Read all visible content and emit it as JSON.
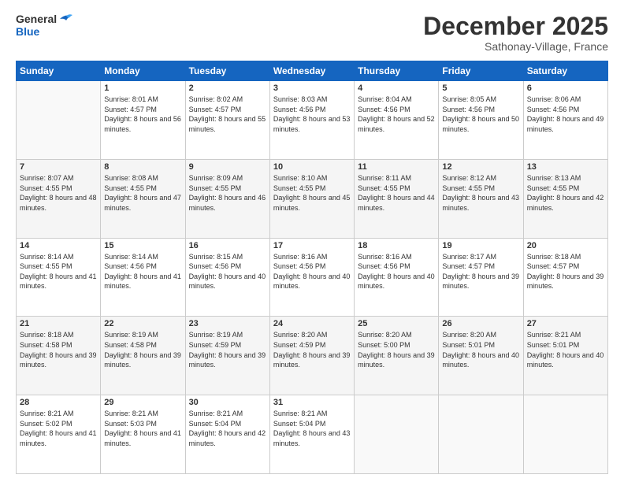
{
  "logo": {
    "line1": "General",
    "line2": "Blue"
  },
  "header": {
    "month": "December 2025",
    "location": "Sathonay-Village, France"
  },
  "weekdays": [
    "Sunday",
    "Monday",
    "Tuesday",
    "Wednesday",
    "Thursday",
    "Friday",
    "Saturday"
  ],
  "weeks": [
    [
      {
        "day": "",
        "sunrise": "",
        "sunset": "",
        "daylight": ""
      },
      {
        "day": "1",
        "sunrise": "Sunrise: 8:01 AM",
        "sunset": "Sunset: 4:57 PM",
        "daylight": "Daylight: 8 hours and 56 minutes."
      },
      {
        "day": "2",
        "sunrise": "Sunrise: 8:02 AM",
        "sunset": "Sunset: 4:57 PM",
        "daylight": "Daylight: 8 hours and 55 minutes."
      },
      {
        "day": "3",
        "sunrise": "Sunrise: 8:03 AM",
        "sunset": "Sunset: 4:56 PM",
        "daylight": "Daylight: 8 hours and 53 minutes."
      },
      {
        "day": "4",
        "sunrise": "Sunrise: 8:04 AM",
        "sunset": "Sunset: 4:56 PM",
        "daylight": "Daylight: 8 hours and 52 minutes."
      },
      {
        "day": "5",
        "sunrise": "Sunrise: 8:05 AM",
        "sunset": "Sunset: 4:56 PM",
        "daylight": "Daylight: 8 hours and 50 minutes."
      },
      {
        "day": "6",
        "sunrise": "Sunrise: 8:06 AM",
        "sunset": "Sunset: 4:56 PM",
        "daylight": "Daylight: 8 hours and 49 minutes."
      }
    ],
    [
      {
        "day": "7",
        "sunrise": "Sunrise: 8:07 AM",
        "sunset": "Sunset: 4:55 PM",
        "daylight": "Daylight: 8 hours and 48 minutes."
      },
      {
        "day": "8",
        "sunrise": "Sunrise: 8:08 AM",
        "sunset": "Sunset: 4:55 PM",
        "daylight": "Daylight: 8 hours and 47 minutes."
      },
      {
        "day": "9",
        "sunrise": "Sunrise: 8:09 AM",
        "sunset": "Sunset: 4:55 PM",
        "daylight": "Daylight: 8 hours and 46 minutes."
      },
      {
        "day": "10",
        "sunrise": "Sunrise: 8:10 AM",
        "sunset": "Sunset: 4:55 PM",
        "daylight": "Daylight: 8 hours and 45 minutes."
      },
      {
        "day": "11",
        "sunrise": "Sunrise: 8:11 AM",
        "sunset": "Sunset: 4:55 PM",
        "daylight": "Daylight: 8 hours and 44 minutes."
      },
      {
        "day": "12",
        "sunrise": "Sunrise: 8:12 AM",
        "sunset": "Sunset: 4:55 PM",
        "daylight": "Daylight: 8 hours and 43 minutes."
      },
      {
        "day": "13",
        "sunrise": "Sunrise: 8:13 AM",
        "sunset": "Sunset: 4:55 PM",
        "daylight": "Daylight: 8 hours and 42 minutes."
      }
    ],
    [
      {
        "day": "14",
        "sunrise": "Sunrise: 8:14 AM",
        "sunset": "Sunset: 4:55 PM",
        "daylight": "Daylight: 8 hours and 41 minutes."
      },
      {
        "day": "15",
        "sunrise": "Sunrise: 8:14 AM",
        "sunset": "Sunset: 4:56 PM",
        "daylight": "Daylight: 8 hours and 41 minutes."
      },
      {
        "day": "16",
        "sunrise": "Sunrise: 8:15 AM",
        "sunset": "Sunset: 4:56 PM",
        "daylight": "Daylight: 8 hours and 40 minutes."
      },
      {
        "day": "17",
        "sunrise": "Sunrise: 8:16 AM",
        "sunset": "Sunset: 4:56 PM",
        "daylight": "Daylight: 8 hours and 40 minutes."
      },
      {
        "day": "18",
        "sunrise": "Sunrise: 8:16 AM",
        "sunset": "Sunset: 4:56 PM",
        "daylight": "Daylight: 8 hours and 40 minutes."
      },
      {
        "day": "19",
        "sunrise": "Sunrise: 8:17 AM",
        "sunset": "Sunset: 4:57 PM",
        "daylight": "Daylight: 8 hours and 39 minutes."
      },
      {
        "day": "20",
        "sunrise": "Sunrise: 8:18 AM",
        "sunset": "Sunset: 4:57 PM",
        "daylight": "Daylight: 8 hours and 39 minutes."
      }
    ],
    [
      {
        "day": "21",
        "sunrise": "Sunrise: 8:18 AM",
        "sunset": "Sunset: 4:58 PM",
        "daylight": "Daylight: 8 hours and 39 minutes."
      },
      {
        "day": "22",
        "sunrise": "Sunrise: 8:19 AM",
        "sunset": "Sunset: 4:58 PM",
        "daylight": "Daylight: 8 hours and 39 minutes."
      },
      {
        "day": "23",
        "sunrise": "Sunrise: 8:19 AM",
        "sunset": "Sunset: 4:59 PM",
        "daylight": "Daylight: 8 hours and 39 minutes."
      },
      {
        "day": "24",
        "sunrise": "Sunrise: 8:20 AM",
        "sunset": "Sunset: 4:59 PM",
        "daylight": "Daylight: 8 hours and 39 minutes."
      },
      {
        "day": "25",
        "sunrise": "Sunrise: 8:20 AM",
        "sunset": "Sunset: 5:00 PM",
        "daylight": "Daylight: 8 hours and 39 minutes."
      },
      {
        "day": "26",
        "sunrise": "Sunrise: 8:20 AM",
        "sunset": "Sunset: 5:01 PM",
        "daylight": "Daylight: 8 hours and 40 minutes."
      },
      {
        "day": "27",
        "sunrise": "Sunrise: 8:21 AM",
        "sunset": "Sunset: 5:01 PM",
        "daylight": "Daylight: 8 hours and 40 minutes."
      }
    ],
    [
      {
        "day": "28",
        "sunrise": "Sunrise: 8:21 AM",
        "sunset": "Sunset: 5:02 PM",
        "daylight": "Daylight: 8 hours and 41 minutes."
      },
      {
        "day": "29",
        "sunrise": "Sunrise: 8:21 AM",
        "sunset": "Sunset: 5:03 PM",
        "daylight": "Daylight: 8 hours and 41 minutes."
      },
      {
        "day": "30",
        "sunrise": "Sunrise: 8:21 AM",
        "sunset": "Sunset: 5:04 PM",
        "daylight": "Daylight: 8 hours and 42 minutes."
      },
      {
        "day": "31",
        "sunrise": "Sunrise: 8:21 AM",
        "sunset": "Sunset: 5:04 PM",
        "daylight": "Daylight: 8 hours and 43 minutes."
      },
      {
        "day": "",
        "sunrise": "",
        "sunset": "",
        "daylight": ""
      },
      {
        "day": "",
        "sunrise": "",
        "sunset": "",
        "daylight": ""
      },
      {
        "day": "",
        "sunrise": "",
        "sunset": "",
        "daylight": ""
      }
    ]
  ]
}
